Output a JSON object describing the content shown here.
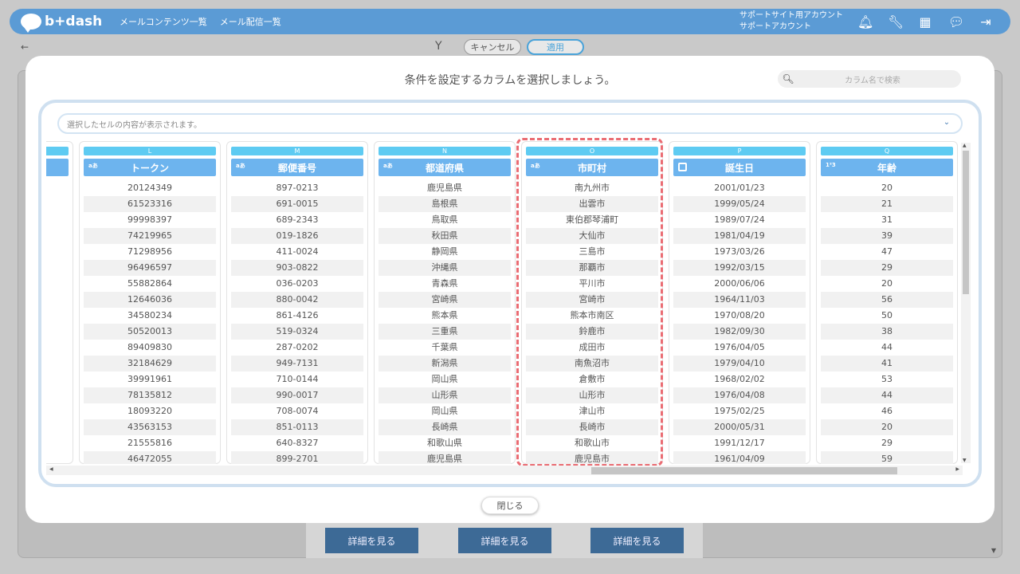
{
  "header": {
    "logo_text": "b+dash",
    "nav": [
      "メールコンテンツ一覧",
      "メール配信一覧"
    ],
    "user_line1": "サポートサイト用アカウント",
    "user_line2": "サポートアカウント",
    "icons": [
      "bell-icon",
      "wrench-icon",
      "grid-icon",
      "chat-icon",
      "logout-icon"
    ]
  },
  "subbar": {
    "back": "←",
    "filter_icon": "filter-icon",
    "cancel": "キャンセル",
    "apply": "適用"
  },
  "background": {
    "detail_buttons": [
      "詳細を見る",
      "詳細を見る",
      "詳細を見る"
    ]
  },
  "modal": {
    "title": "条件を設定するカラムを選択しましょう。",
    "search_placeholder": "カラム名で検索",
    "cell_preview": "選択したセルの内容が表示されます。",
    "close": "閉じる",
    "columns": [
      {
        "letter": "L",
        "name": "トークン",
        "type": "text",
        "values": [
          "20124349",
          "61523316",
          "99998397",
          "74219965",
          "71298956",
          "96496597",
          "55882864",
          "12646036",
          "34580234",
          "50520013",
          "89409830",
          "32184629",
          "39991961",
          "78135812",
          "18093220",
          "43563153",
          "21555816",
          "46472055"
        ]
      },
      {
        "letter": "M",
        "name": "郵便番号",
        "type": "text",
        "values": [
          "897-0213",
          "691-0015",
          "689-2343",
          "019-1826",
          "411-0024",
          "903-0822",
          "036-0203",
          "880-0042",
          "861-4126",
          "519-0324",
          "287-0202",
          "949-7131",
          "710-0144",
          "990-0017",
          "708-0074",
          "851-0113",
          "640-8327",
          "899-2701"
        ]
      },
      {
        "letter": "N",
        "name": "都道府県",
        "type": "text",
        "values": [
          "鹿児島県",
          "島根県",
          "鳥取県",
          "秋田県",
          "静岡県",
          "沖縄県",
          "青森県",
          "宮崎県",
          "熊本県",
          "三重県",
          "千葉県",
          "新潟県",
          "岡山県",
          "山形県",
          "岡山県",
          "長崎県",
          "和歌山県",
          "鹿児島県"
        ]
      },
      {
        "letter": "O",
        "name": "市町村",
        "type": "text",
        "highlighted": true,
        "values": [
          "南九州市",
          "出雲市",
          "東伯郡琴浦町",
          "大仙市",
          "三島市",
          "那覇市",
          "平川市",
          "宮崎市",
          "熊本市南区",
          "鈴鹿市",
          "成田市",
          "南魚沼市",
          "倉敷市",
          "山形市",
          "津山市",
          "長崎市",
          "和歌山市",
          "鹿児島市"
        ]
      },
      {
        "letter": "P",
        "name": "誕生日",
        "type": "date",
        "values": [
          "2001/01/23",
          "1999/05/24",
          "1989/07/24",
          "1981/04/19",
          "1973/03/26",
          "1992/03/15",
          "2000/06/06",
          "1964/11/03",
          "1970/08/20",
          "1982/09/30",
          "1976/04/05",
          "1979/04/10",
          "1968/02/02",
          "1976/04/08",
          "1975/02/25",
          "2000/05/31",
          "1991/12/17",
          "1961/04/09"
        ]
      },
      {
        "letter": "Q",
        "name": "年齢",
        "type": "number",
        "values": [
          "20",
          "21",
          "31",
          "39",
          "47",
          "29",
          "20",
          "56",
          "50",
          "38",
          "44",
          "41",
          "53",
          "44",
          "46",
          "20",
          "29",
          "59"
        ]
      }
    ]
  },
  "colors": {
    "header_blue": "#5b9bd5",
    "column_header": "#6db4ee",
    "letter_bar": "#5ecbf2",
    "highlight": "#ea6c73",
    "detail_button": "#3d6a96"
  }
}
